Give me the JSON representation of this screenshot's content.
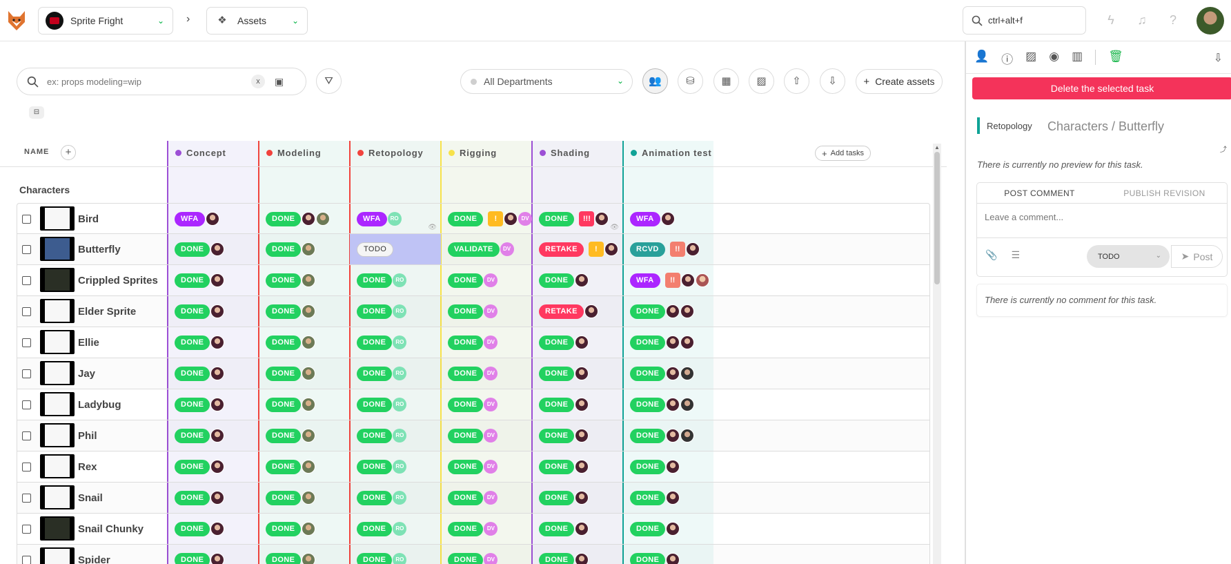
{
  "header": {
    "production": "Sprite Fright",
    "section": "Assets",
    "breadcrumb_sep": "›",
    "search_value": "ctrl+alt+f",
    "icons": [
      "lightning-icon",
      "bell-icon",
      "help-icon",
      "user-avatar"
    ]
  },
  "toolbar": {
    "search_placeholder": "ex: props modeling=wip",
    "clear_label": "x",
    "department": "All Departments",
    "create_label": "Create assets"
  },
  "table": {
    "name_header": "NAME",
    "add_tasks_label": "Add tasks",
    "columns": [
      {
        "name": "Concept",
        "color": "#9c4fd5"
      },
      {
        "name": "Modeling",
        "color": "#f1433d"
      },
      {
        "name": "Retopology",
        "color": "#f1433d"
      },
      {
        "name": "Rigging",
        "color": "#f7e24a"
      },
      {
        "name": "Shading",
        "color": "#9c4fd5"
      },
      {
        "name": "Animation test",
        "color": "#0fa396"
      }
    ],
    "section": "Characters",
    "status_colors": {
      "DONE": "#22d160",
      "WFA": "#ab26ff",
      "TODO": "#f5f5f5",
      "VALIDATE": "#22d160",
      "RETAKE": "#ff3860",
      "RCVD": "#29a09a"
    },
    "rows": [
      {
        "name": "Bird",
        "thumb": "light",
        "tasks": [
          {
            "s": "WFA",
            "a": [
              "p1"
            ]
          },
          {
            "s": "DONE",
            "a": [
              "p1",
              "p2"
            ]
          },
          {
            "s": "WFA",
            "a": [
              "RO"
            ],
            "eye": true
          },
          {
            "s": "DONE",
            "prio": "!",
            "a": [
              "p1",
              "DV"
            ]
          },
          {
            "s": "DONE",
            "prio": "!!!",
            "a": [
              "p1"
            ],
            "eye": true
          },
          {
            "s": "WFA",
            "a": [
              "p1"
            ]
          }
        ]
      },
      {
        "name": "Butterfly",
        "thumb": "blue",
        "tasks": [
          {
            "s": "DONE",
            "a": [
              "p1"
            ]
          },
          {
            "s": "DONE",
            "a": [
              "p2"
            ]
          },
          {
            "s": "TODO",
            "a": [],
            "sel": true
          },
          {
            "s": "VALIDATE",
            "a": [
              "DV"
            ]
          },
          {
            "s": "RETAKE",
            "prio": "!",
            "a": [
              "p1"
            ]
          },
          {
            "s": "RCVD",
            "prio": "!!",
            "a": [
              "p1"
            ]
          }
        ]
      },
      {
        "name": "Crippled Sprites",
        "thumb": "dark",
        "tasks": [
          {
            "s": "DONE",
            "a": [
              "p1"
            ]
          },
          {
            "s": "DONE",
            "a": [
              "p2"
            ]
          },
          {
            "s": "DONE",
            "a": [
              "RO"
            ]
          },
          {
            "s": "DONE",
            "a": [
              "DV"
            ]
          },
          {
            "s": "DONE",
            "a": [
              "p1"
            ]
          },
          {
            "s": "WFA",
            "prio": "!!",
            "a": [
              "p1",
              "p4"
            ]
          }
        ]
      },
      {
        "name": "Elder Sprite",
        "thumb": "light",
        "tasks": [
          {
            "s": "DONE",
            "a": [
              "p1"
            ]
          },
          {
            "s": "DONE",
            "a": [
              "p2"
            ]
          },
          {
            "s": "DONE",
            "a": [
              "RO"
            ]
          },
          {
            "s": "DONE",
            "a": [
              "DV"
            ]
          },
          {
            "s": "RETAKE",
            "a": [
              "p1"
            ]
          },
          {
            "s": "DONE",
            "a": [
              "p1",
              "p1"
            ]
          }
        ]
      },
      {
        "name": "Ellie",
        "thumb": "light",
        "tasks": [
          {
            "s": "DONE",
            "a": [
              "p1"
            ]
          },
          {
            "s": "DONE",
            "a": [
              "p2"
            ]
          },
          {
            "s": "DONE",
            "a": [
              "RO"
            ]
          },
          {
            "s": "DONE",
            "a": [
              "DV"
            ]
          },
          {
            "s": "DONE",
            "a": [
              "p1"
            ]
          },
          {
            "s": "DONE",
            "a": [
              "p1",
              "p1"
            ]
          }
        ]
      },
      {
        "name": "Jay",
        "thumb": "light",
        "tasks": [
          {
            "s": "DONE",
            "a": [
              "p1"
            ]
          },
          {
            "s": "DONE",
            "a": [
              "p2"
            ]
          },
          {
            "s": "DONE",
            "a": [
              "RO"
            ]
          },
          {
            "s": "DONE",
            "a": [
              "DV"
            ]
          },
          {
            "s": "DONE",
            "a": [
              "p1"
            ]
          },
          {
            "s": "DONE",
            "a": [
              "p1",
              "p3"
            ]
          }
        ]
      },
      {
        "name": "Ladybug",
        "thumb": "light",
        "tasks": [
          {
            "s": "DONE",
            "a": [
              "p1"
            ]
          },
          {
            "s": "DONE",
            "a": [
              "p2"
            ]
          },
          {
            "s": "DONE",
            "a": [
              "RO"
            ]
          },
          {
            "s": "DONE",
            "a": [
              "DV"
            ]
          },
          {
            "s": "DONE",
            "a": [
              "p1"
            ]
          },
          {
            "s": "DONE",
            "a": [
              "p1",
              "p3"
            ]
          }
        ]
      },
      {
        "name": "Phil",
        "thumb": "light",
        "tasks": [
          {
            "s": "DONE",
            "a": [
              "p1"
            ]
          },
          {
            "s": "DONE",
            "a": [
              "p2"
            ]
          },
          {
            "s": "DONE",
            "a": [
              "RO"
            ]
          },
          {
            "s": "DONE",
            "a": [
              "DV"
            ]
          },
          {
            "s": "DONE",
            "a": [
              "p1"
            ]
          },
          {
            "s": "DONE",
            "a": [
              "p1",
              "p3"
            ]
          }
        ]
      },
      {
        "name": "Rex",
        "thumb": "light",
        "tasks": [
          {
            "s": "DONE",
            "a": [
              "p1"
            ]
          },
          {
            "s": "DONE",
            "a": [
              "p2"
            ]
          },
          {
            "s": "DONE",
            "a": [
              "RO"
            ]
          },
          {
            "s": "DONE",
            "a": [
              "DV"
            ]
          },
          {
            "s": "DONE",
            "a": [
              "p1"
            ]
          },
          {
            "s": "DONE",
            "a": [
              "p1"
            ]
          }
        ]
      },
      {
        "name": "Snail",
        "thumb": "light",
        "tasks": [
          {
            "s": "DONE",
            "a": [
              "p1"
            ]
          },
          {
            "s": "DONE",
            "a": [
              "p2"
            ]
          },
          {
            "s": "DONE",
            "a": [
              "RO"
            ]
          },
          {
            "s": "DONE",
            "a": [
              "DV"
            ]
          },
          {
            "s": "DONE",
            "a": [
              "p1"
            ]
          },
          {
            "s": "DONE",
            "a": [
              "p1"
            ]
          }
        ]
      },
      {
        "name": "Snail Chunky",
        "thumb": "dark",
        "tasks": [
          {
            "s": "DONE",
            "a": [
              "p1"
            ]
          },
          {
            "s": "DONE",
            "a": [
              "p2"
            ]
          },
          {
            "s": "DONE",
            "a": [
              "RO"
            ]
          },
          {
            "s": "DONE",
            "a": [
              "DV"
            ]
          },
          {
            "s": "DONE",
            "a": [
              "p1"
            ]
          },
          {
            "s": "DONE",
            "a": [
              "p1"
            ]
          }
        ]
      },
      {
        "name": "Spider",
        "thumb": "light",
        "tasks": [
          {
            "s": "DONE",
            "a": [
              "p1"
            ]
          },
          {
            "s": "DONE",
            "a": [
              "p2"
            ]
          },
          {
            "s": "DONE",
            "a": [
              "RO"
            ]
          },
          {
            "s": "DONE",
            "a": [
              "DV"
            ]
          },
          {
            "s": "DONE",
            "a": [
              "p1"
            ]
          },
          {
            "s": "DONE",
            "a": [
              "p1"
            ]
          }
        ]
      }
    ]
  },
  "side": {
    "delete_label": "Delete the selected task",
    "task_type": "Retopology",
    "task_title": "Characters / Butterfly",
    "no_preview": "There is currently no preview for this task.",
    "tab_post": "POST COMMENT",
    "tab_publish": "PUBLISH REVISION",
    "comment_placeholder": "Leave a comment...",
    "status_value": "TODO",
    "post_label": "Post",
    "no_comment": "There is currently no comment for this task."
  }
}
